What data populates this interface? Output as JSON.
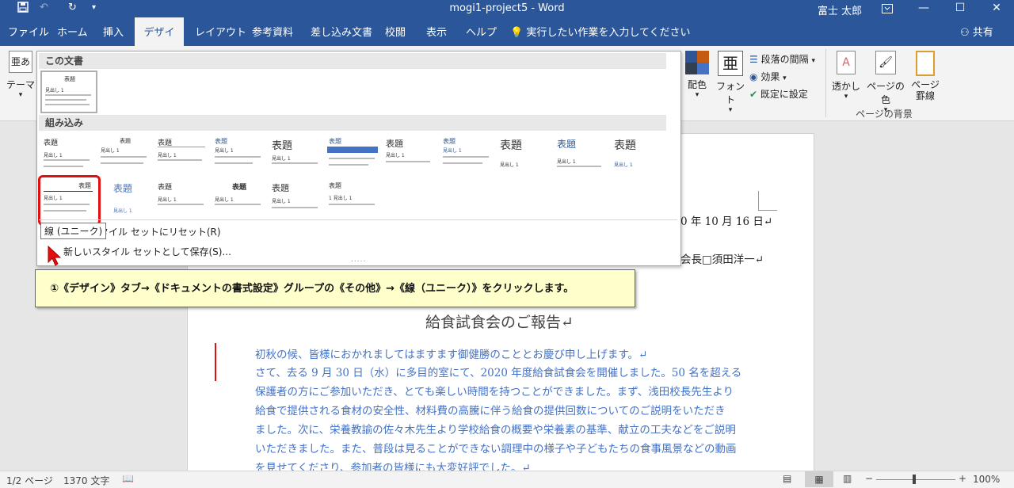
{
  "titlebar": {
    "doc_title": "mogi1-project5  -  Word",
    "user": "富士 太郎",
    "save_icon": "save-icon",
    "undo_icon": "undo-icon",
    "redo_icon": "redo-icon",
    "customize_icon": "customize-icon"
  },
  "tabs": [
    "ファイル",
    "ホーム",
    "挿入",
    "デザイン",
    "レイアウト",
    "参考資料",
    "差し込み文書",
    "校閲",
    "表示",
    "ヘルプ"
  ],
  "active_tab": "デザイン",
  "tell_me": "実行したい作業を入力してください",
  "share": "共有",
  "ribbon": {
    "theme": "テーマ",
    "colors": "配色",
    "fonts": "フォント",
    "paragraph_spacing": "段落の間隔",
    "effects": "効果",
    "set_default": "既定に設定",
    "watermark": "透かし",
    "page_color": "ページの色",
    "page_borders": "ページ罫線",
    "group_page_bg": "ページの背景",
    "fonts_icon_char": "亜"
  },
  "gallery": {
    "this_document": "この文書",
    "builtin": "組み込み",
    "thumb_title": "表題",
    "thumb_heading": "見出し 1",
    "thumb_heading_alt": "1 見出し 1",
    "reset_label": "タイル セットにリセット(R)",
    "save_label": "新しいスタイル セットとして保存(S)...",
    "tooltip": "線 (ユニーク)",
    "grip": "....."
  },
  "callout": "①《デザイン》タブ→《ドキュメントの書式設定》グループの《その他》→《線（ユニーク）》をクリックします。",
  "document": {
    "date": "0 年 10 月 16 日↵",
    "sender": "会長□須田洋一↵",
    "title": "給食試食会のご報告↵",
    "lines": [
      "初秋の候、皆様におかれましてはますます御健勝のこととお慶び申し上げます。↵",
      "さて、去る 9 月 30 日（水）に多目的室にて、2020 年度給食試食会を開催しました。50 名を超える",
      "保護者の方にご参加いただき、とても楽しい時間を持つことができました。まず、浅田校長先生より",
      "給食で提供される食材の安全性、材料費の高騰に伴う給食の提供回数についてのご説明をいただき",
      "ました。次に、栄養教諭の佐々木先生より学校給食の概要や栄養素の基準、献立の工夫などをご説明",
      "いただきました。また、普段は見ることができない調理中の様子や子どもたちの食事風景などの動画",
      "を見せてくださり、参加者の皆様にも大変好評でした。↵"
    ]
  },
  "status": {
    "pages": "1/2 ページ",
    "words": "1370 文字",
    "zoom": "100%",
    "zoom_minus": "−",
    "zoom_plus": "+"
  },
  "colors": {
    "titlebar": "#2b579a",
    "accent_red": "#e01010",
    "doc_text": "#4472c4",
    "callout_bg": "#ffffcc"
  }
}
